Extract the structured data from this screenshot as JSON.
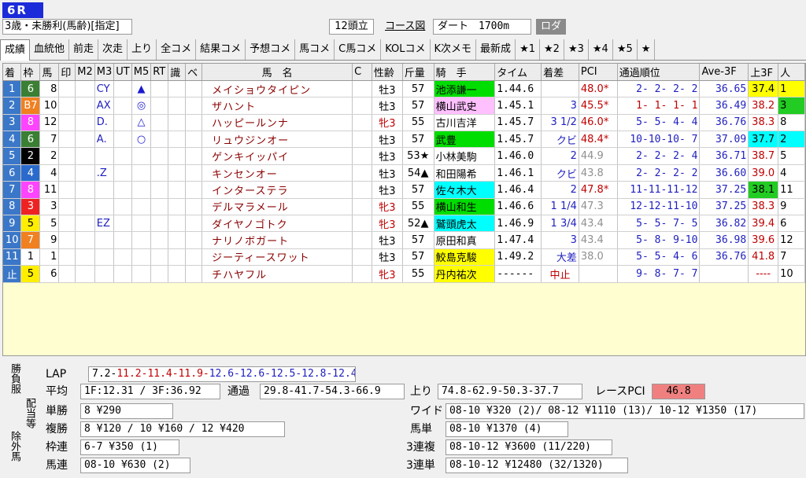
{
  "header": {
    "race_number": "6R",
    "race_condition": "3歳・未勝利(馬齢)[指定]",
    "field_size": "12頭立",
    "course_link": "コース図",
    "track": "ダート　1700m",
    "roda_button": "ロダ"
  },
  "tabs": [
    "成績",
    "血統他",
    "前走",
    "次走",
    "上り",
    "全コメ",
    "結果コメ",
    "予想コメ",
    "馬コメ",
    "C馬コメ",
    "KOLコメ",
    "K次メモ",
    "最新成",
    "★1",
    "★2",
    "★3",
    "★4",
    "★5",
    "★"
  ],
  "columns": [
    "着",
    "枠",
    "馬",
    "印",
    "M2",
    "M3",
    "UT",
    "M5",
    "RT",
    "識",
    "ベ",
    "馬　名",
    "C",
    "性齢",
    "斤量",
    "騎　手",
    "タイム",
    "着差",
    "PCI",
    "通過順位",
    "Ave-3F",
    "上3F",
    "人"
  ],
  "rows": [
    {
      "ord": "1",
      "waku": "6",
      "uma": "8",
      "m3": "CY",
      "m5": "▲",
      "name": "メイショウタイピン",
      "sex": "牡3",
      "kin": "57",
      "jockey": "池添謙一",
      "time": "1.44.6",
      "margin": "",
      "pci": "48.0*",
      "pass": "2- 2- 2- 2",
      "ave3f": "36.65",
      "up3f": "37.4",
      "pop": "1",
      "ordColor": "#3a77c8",
      "wakuBg": "#3a7f33",
      "wakuFg": "#fff",
      "jockeyBg": "#00dd00",
      "up3fBg": "#ffff00",
      "popBg": "#ffff00",
      "sexRed": false,
      "pciRed": true,
      "passRed": false,
      "up3fRed": false
    },
    {
      "ord": "2",
      "waku": "B7",
      "uma": "10",
      "m3": "AX",
      "m5": "◎",
      "name": "ザハント",
      "sex": "牡3",
      "kin": "57",
      "jockey": "横山武史",
      "time": "1.45.1",
      "margin": "3",
      "pci": "45.5*",
      "pass": "1- 1- 1- 1",
      "ave3f": "36.49",
      "up3f": "38.2",
      "pop": "3",
      "ordColor": "#3a77c8",
      "wakuBg": "#f08020",
      "wakuFg": "#fff",
      "jockeyBg": "#ffc0ff",
      "up3fBg": "#fff",
      "popBg": "#22cc22",
      "sexRed": false,
      "pciRed": true,
      "passRed": true,
      "up3fRed": true
    },
    {
      "ord": "3",
      "waku": "8",
      "uma": "12",
      "m3": "D.",
      "m5": "△",
      "name": "ハッピールンナ",
      "sex": "牝3",
      "kin": "55",
      "jockey": "古川吉洋",
      "time": "1.45.7",
      "margin": "3 1/2",
      "pci": "46.0*",
      "pass": "5- 5- 4- 4",
      "ave3f": "36.76",
      "up3f": "38.3",
      "pop": "8",
      "ordColor": "#3a77c8",
      "wakuBg": "#ff44ff",
      "wakuFg": "#fff",
      "jockeyBg": "#fff",
      "up3fBg": "#fff",
      "popBg": "#fff",
      "sexRed": true,
      "pciRed": true,
      "passRed": false,
      "up3fRed": true
    },
    {
      "ord": "4",
      "waku": "6",
      "uma": "7",
      "m3": "A.",
      "m5": "○",
      "name": "リュウジンオー",
      "sex": "牡3",
      "kin": "57",
      "jockey": "武豊",
      "time": "1.45.7",
      "margin": "クビ",
      "pci": "48.4*",
      "pass": "10-10-10- 7",
      "ave3f": "37.09",
      "up3f": "37.7",
      "pop": "2",
      "ordColor": "#3a77c8",
      "wakuBg": "#3a7f33",
      "wakuFg": "#fff",
      "jockeyBg": "#00dd00",
      "up3fBg": "#00ffff",
      "popBg": "#00ffff",
      "sexRed": false,
      "pciRed": true,
      "passRed": false,
      "up3fRed": false
    },
    {
      "ord": "5",
      "waku": "2",
      "uma": "2",
      "m3": "",
      "m5": "",
      "name": "ゲンキイッパイ",
      "sex": "牡3",
      "kin": "53★",
      "jockey": "小林美駒",
      "time": "1.46.0",
      "margin": "2",
      "pci": "44.9",
      "pass": "2- 2- 2- 4",
      "ave3f": "36.71",
      "up3f": "38.7",
      "pop": "5",
      "ordColor": "#3a77c8",
      "wakuBg": "#000",
      "wakuFg": "#fff",
      "jockeyBg": "#fff",
      "up3fBg": "#fff",
      "popBg": "#fff",
      "sexRed": false,
      "pciRed": false,
      "passRed": false,
      "up3fRed": true
    },
    {
      "ord": "6",
      "waku": "4",
      "uma": "4",
      "m3": ".Z",
      "m5": "",
      "name": "キンセンオー",
      "sex": "牡3",
      "kin": "54▲",
      "jockey": "和田陽希",
      "time": "1.46.1",
      "margin": "クビ",
      "pci": "43.8",
      "pass": "2- 2- 2- 2",
      "ave3f": "36.60",
      "up3f": "39.0",
      "pop": "4",
      "ordColor": "#3a77c8",
      "wakuBg": "#2a6acc",
      "wakuFg": "#fff",
      "jockeyBg": "#fff",
      "up3fBg": "#fff",
      "popBg": "#fff",
      "sexRed": false,
      "pciRed": false,
      "passRed": false,
      "up3fRed": true
    },
    {
      "ord": "7",
      "waku": "8",
      "uma": "11",
      "m3": "",
      "m5": "",
      "name": "インターステラ",
      "sex": "牡3",
      "kin": "57",
      "jockey": "佐々木大",
      "time": "1.46.4",
      "margin": "2",
      "pci": "47.8*",
      "pass": "11-11-11-12",
      "ave3f": "37.25",
      "up3f": "38.1",
      "pop": "11",
      "ordColor": "#3a77c8",
      "wakuBg": "#ff44ff",
      "wakuFg": "#fff",
      "jockeyBg": "#00ffff",
      "up3fBg": "#22cc22",
      "popBg": "#fff",
      "sexRed": false,
      "pciRed": true,
      "passRed": false,
      "up3fRed": false
    },
    {
      "ord": "8",
      "waku": "3",
      "uma": "3",
      "m3": "",
      "m5": "",
      "name": "デルマラメール",
      "sex": "牝3",
      "kin": "55",
      "jockey": "横山和生",
      "time": "1.46.6",
      "margin": "1 1/4",
      "pci": "47.3",
      "pass": "12-12-11-10",
      "ave3f": "37.25",
      "up3f": "38.3",
      "pop": "9",
      "ordColor": "#3a77c8",
      "wakuBg": "#ee2222",
      "wakuFg": "#fff",
      "jockeyBg": "#00dd00",
      "up3fBg": "#fff",
      "popBg": "#fff",
      "sexRed": true,
      "pciRed": false,
      "passRed": false,
      "up3fRed": true
    },
    {
      "ord": "9",
      "waku": "5",
      "uma": "5",
      "m3": "EZ",
      "m5": "",
      "name": "ダイヤノゴトク",
      "sex": "牝3",
      "kin": "52▲",
      "jockey": "鷲頭虎太",
      "time": "1.46.9",
      "margin": "1 3/4",
      "pci": "43.4",
      "pass": "5- 5- 7- 5",
      "ave3f": "36.82",
      "up3f": "39.4",
      "pop": "6",
      "ordColor": "#3a77c8",
      "wakuBg": "#ffee00",
      "wakuFg": "#000",
      "jockeyBg": "#00ffff",
      "up3fBg": "#fff",
      "popBg": "#fff",
      "sexRed": true,
      "pciRed": false,
      "passRed": false,
      "up3fRed": true
    },
    {
      "ord": "10",
      "waku": "7",
      "uma": "9",
      "m3": "",
      "m5": "",
      "name": "ナリノボガート",
      "sex": "牡3",
      "kin": "57",
      "jockey": "原田和真",
      "time": "1.47.4",
      "margin": "3",
      "pci": "43.4",
      "pass": "5- 8- 9-10",
      "ave3f": "36.98",
      "up3f": "39.6",
      "pop": "12",
      "ordColor": "#3a77c8",
      "wakuBg": "#f08020",
      "wakuFg": "#fff",
      "jockeyBg": "#fff",
      "up3fBg": "#fff",
      "popBg": "#fff",
      "sexRed": false,
      "pciRed": false,
      "passRed": false,
      "up3fRed": true
    },
    {
      "ord": "11",
      "waku": "1",
      "uma": "1",
      "m3": "",
      "m5": "",
      "name": "ジーティースワット",
      "sex": "牡3",
      "kin": "57",
      "jockey": "鮫島克駿",
      "time": "1.49.2",
      "margin": "大差",
      "pci": "38.0",
      "pass": "5- 5- 4- 6",
      "ave3f": "36.76",
      "up3f": "41.8",
      "pop": "7",
      "ordColor": "#3a77c8",
      "wakuBg": "#fff",
      "wakuFg": "#000",
      "jockeyBg": "#ffff00",
      "up3fBg": "#fff",
      "popBg": "#fff",
      "sexRed": false,
      "pciRed": false,
      "passRed": false,
      "up3fRed": true
    },
    {
      "ord": "止",
      "waku": "5",
      "uma": "6",
      "m3": "",
      "m5": "",
      "name": "チハヤフル",
      "sex": "牝3",
      "kin": "55",
      "jockey": "丹内祐次",
      "time": "------",
      "margin": "中止",
      "pci": "",
      "pass": "9- 8- 7- 7",
      "ave3f": "",
      "up3f": "----",
      "pop": "10",
      "ordColor": "#3a77c8",
      "wakuBg": "#ffee00",
      "wakuFg": "#000",
      "jockeyBg": "#ffff00",
      "up3fBg": "#fff",
      "popBg": "#fff",
      "sexRed": true,
      "pciRed": false,
      "passRed": false,
      "up3fRed": true
    }
  ],
  "bottom": {
    "side_tabs": [
      "勝負服",
      "配当等",
      "除外馬"
    ],
    "lap_label": "LAP",
    "lap_segments": [
      {
        "text": "7.2-",
        "color": "#000"
      },
      {
        "text": "11.2-",
        "color": "#c00000"
      },
      {
        "text": "11.4-",
        "color": "#c00000"
      },
      {
        "text": "11.9-",
        "color": "#c00000"
      },
      {
        "text": "12.6-",
        "color": "#2020c0"
      },
      {
        "text": "12.6-",
        "color": "#2020c0"
      },
      {
        "text": "12.5-",
        "color": "#2020c0"
      },
      {
        "text": "12.8-",
        "color": "#2020c0"
      },
      {
        "text": "12.4",
        "color": "#2020c0"
      }
    ],
    "avg_label": "平均",
    "avg_value": "1F:12.31 / 3F:36.92",
    "passing_label": "通過",
    "passing_value": "29.8-41.7-54.3-66.9",
    "agari_label": "上り",
    "agari_value": "74.8-62.9-50.3-37.7",
    "race_pci_label": "レースPCI",
    "race_pci_value": "46.8",
    "race_pci_color": "#f08080",
    "tansho_label": "単勝",
    "tansho_value": "8 ¥290",
    "fukusho_label": "複勝",
    "fukusho_value": "8 ¥120 / 10 ¥160 / 12 ¥420",
    "wakuren_label": "枠連",
    "wakuren_value": "6-7 ¥350 (1)",
    "umaren_label": "馬連",
    "umaren_value": "08-10 ¥630 (2)",
    "wide_label": "ワイド",
    "wide_value": "08-10 ¥320 (2)/ 08-12 ¥1110 (13)/ 10-12 ¥1350 (17)",
    "umatan_label": "馬単",
    "umatan_value": "08-10 ¥1370 (4)",
    "sanrenpuku_label": "3連複",
    "sanrenpuku_value": "08-10-12 ¥3600 (11/220)",
    "sanrentan_label": "3連単",
    "sanrentan_value": "08-10-12 ¥12480 (32/1320)"
  }
}
